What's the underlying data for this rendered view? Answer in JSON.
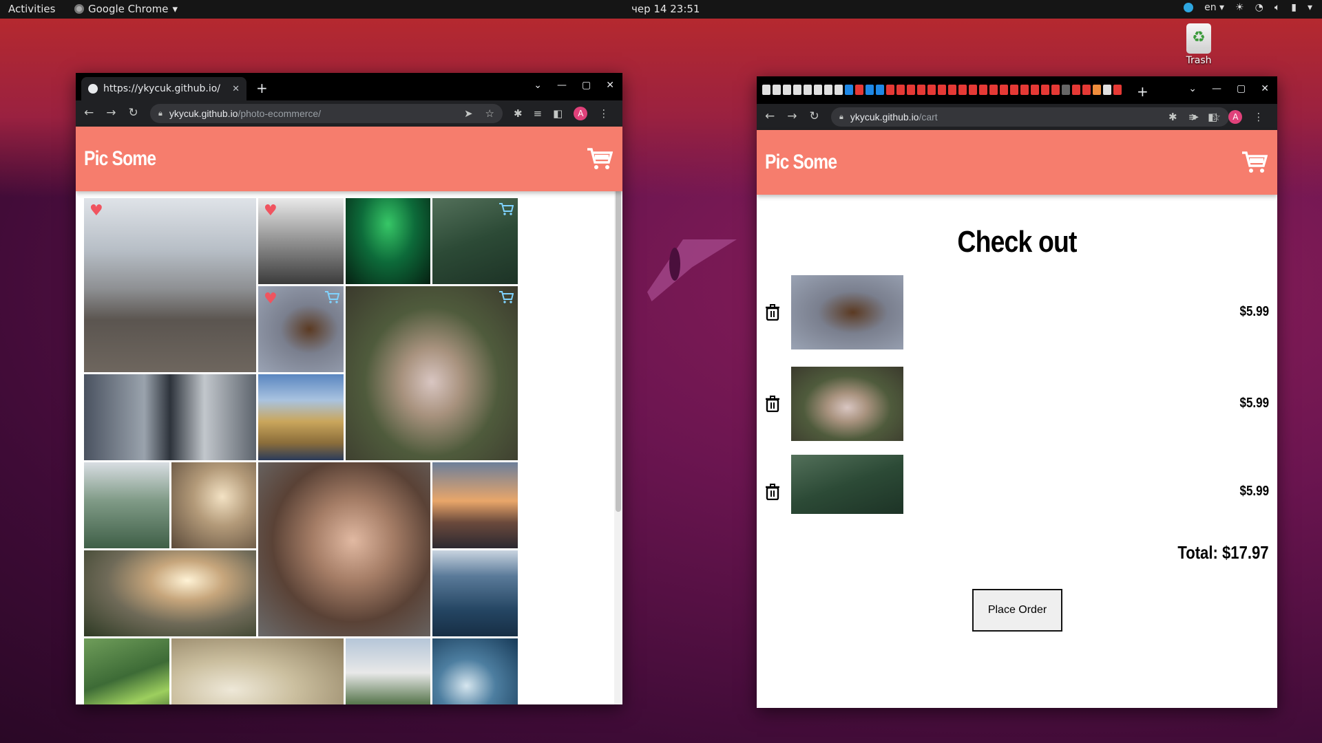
{
  "topbar": {
    "activities": "Activities",
    "app_name": "Google Chrome",
    "clock": "чер 14  23:51",
    "lang": "en"
  },
  "desktop": {
    "trash_label": "Trash"
  },
  "left_window": {
    "tab_title": "https://ykycuk.github.io/",
    "url_host": "ykycuk.github.io",
    "url_path": "/photo-ecommerce/",
    "avatar_letter": "A",
    "site_title": "Pic Some",
    "photos": [
      {
        "name": "bear",
        "fav": true,
        "in_cart": false
      },
      {
        "name": "misty-forest",
        "fav": true,
        "in_cart": false
      },
      {
        "name": "aurora",
        "fav": false,
        "in_cart": false
      },
      {
        "name": "pine-forest",
        "fav": false,
        "in_cart": true
      },
      {
        "name": "eagle",
        "fav": true,
        "in_cart": true
      },
      {
        "name": "pug-blanket",
        "fav": false,
        "in_cart": true
      },
      {
        "name": "skyscraper",
        "fav": false,
        "in_cart": false
      },
      {
        "name": "field-feet",
        "fav": false,
        "in_cart": false
      },
      {
        "name": "city-park",
        "fav": false,
        "in_cart": false
      },
      {
        "name": "dead-trees",
        "fav": false,
        "in_cart": false
      },
      {
        "name": "woman-portrait",
        "fav": false,
        "in_cart": false
      },
      {
        "name": "railway-sunset",
        "fav": false,
        "in_cart": false
      },
      {
        "name": "valley-sunrise",
        "fav": false,
        "in_cart": false
      },
      {
        "name": "ocean",
        "fav": false,
        "in_cart": false
      },
      {
        "name": "waterfall",
        "fav": false,
        "in_cart": false
      },
      {
        "name": "dreamcatcher",
        "fav": false,
        "in_cart": false
      },
      {
        "name": "castle",
        "fav": false,
        "in_cart": false
      },
      {
        "name": "wave",
        "fav": false,
        "in_cart": false
      }
    ]
  },
  "right_window": {
    "url_host": "ykycuk.github.io",
    "url_path": "/cart",
    "avatar_letter": "A",
    "site_title": "Pic Some",
    "heading": "Check out",
    "items": [
      {
        "name": "eagle",
        "price": "$5.99"
      },
      {
        "name": "pug-blanket",
        "price": "$5.99"
      },
      {
        "name": "pine-forest",
        "price": "$5.99"
      }
    ],
    "total": "Total: $17.97",
    "place_order": "Place Order"
  },
  "colors": {
    "header": "#f67d6d",
    "heart": "#f0545f",
    "cart_badge": "#7fd3ff"
  }
}
